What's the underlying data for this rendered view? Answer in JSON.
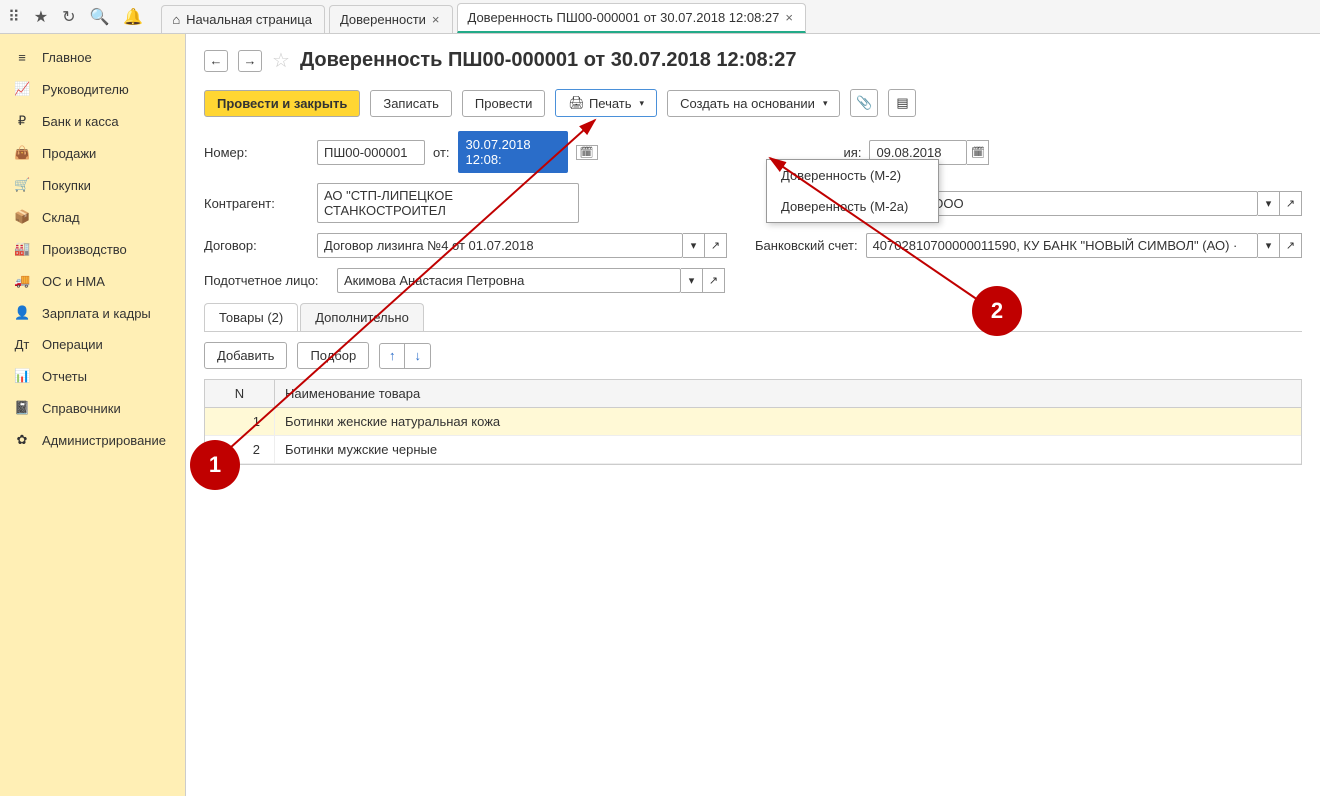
{
  "toolbar": {
    "tabs": {
      "home": "Начальная страница",
      "tab1": "Доверенности",
      "tab2": "Доверенность ПШ00-000001 от 30.07.2018 12:08:27"
    }
  },
  "sidebar": {
    "items": [
      "Главное",
      "Руководителю",
      "Банк и касса",
      "Продажи",
      "Покупки",
      "Склад",
      "Производство",
      "ОС и НМА",
      "Зарплата и кадры",
      "Операции",
      "Отчеты",
      "Справочники",
      "Администрирование"
    ]
  },
  "page": {
    "title": "Доверенность ПШ00-000001 от 30.07.2018 12:08:27"
  },
  "cmd": {
    "post_close": "Провести и закрыть",
    "save": "Записать",
    "post": "Провести",
    "print": "Печать",
    "create_based": "Создать на основании"
  },
  "form": {
    "number_lbl": "Номер:",
    "number_val": "ПШ00-000001",
    "ot_lbl": "от:",
    "date_val": "30.07.2018 12:08:",
    "validity_lbl": "ия:",
    "validity_val": "09.08.2018",
    "counterparty_lbl": "Контрагент:",
    "counterparty_val": "АО \"СТП-ЛИПЕЦКОЕ СТАНКОСТРОИТЕЛ",
    "org_val": "РУС-ШИНА ООО",
    "contract_lbl": "Договор:",
    "contract_val": "Договор лизинга №4 от 01.07.2018",
    "bank_lbl": "Банковский счет:",
    "bank_val": "40702810700000011590, КУ БАНК \"НОВЫЙ СИМВОЛ\" (АО) ·",
    "person_lbl": "Подотчетное лицо:",
    "person_val": "Акимова Анастасия Петровна"
  },
  "tabs": {
    "goods": "Товары (2)",
    "extra": "Дополнительно"
  },
  "tbl": {
    "add": "Добавить",
    "pick": "Подбор",
    "col_num": "N",
    "col_name": "Наименование товара",
    "rows": [
      {
        "n": "1",
        "name": "Ботинки женские натуральная кожа"
      },
      {
        "n": "2",
        "name": "Ботинки мужские черные"
      }
    ]
  },
  "print_menu": {
    "m2": "Доверенность (М-2)",
    "m2a": "Доверенность (М-2а)"
  },
  "anno": {
    "one": "1",
    "two": "2"
  }
}
